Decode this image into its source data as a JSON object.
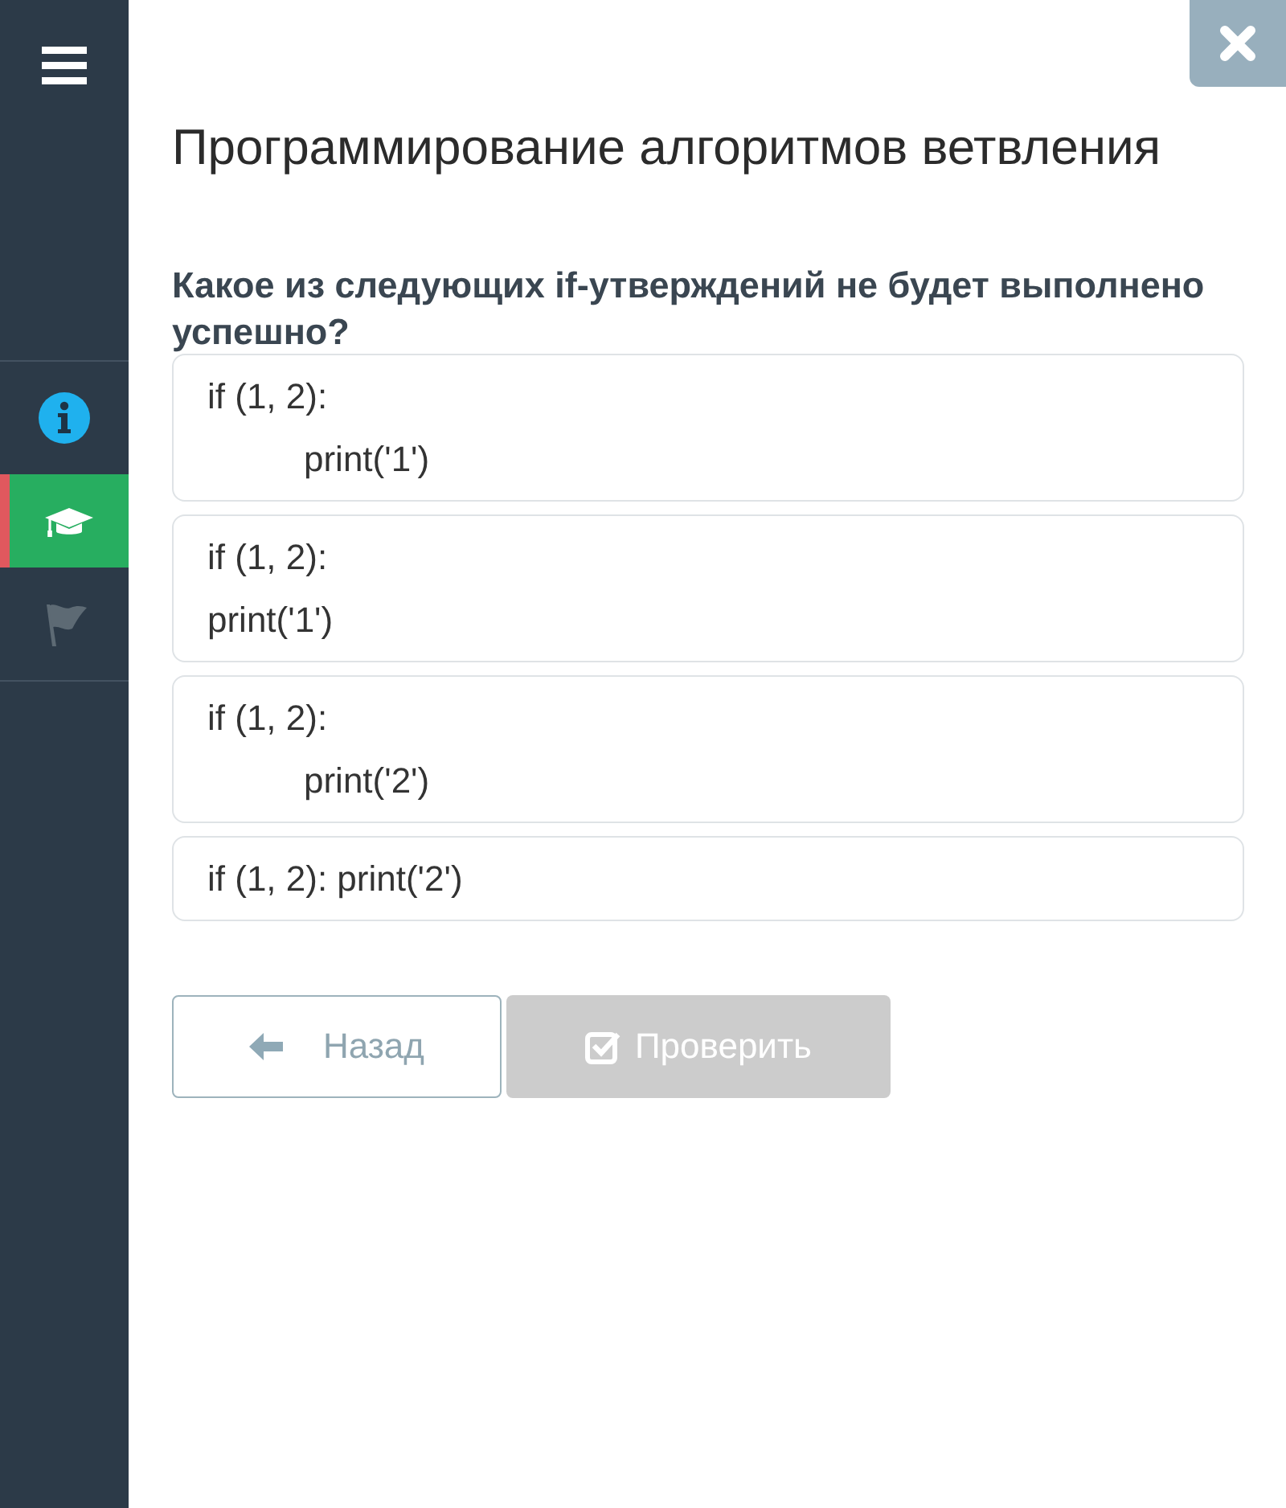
{
  "sidebar": {
    "items": [
      {
        "selected": false,
        "disabled": false
      },
      {
        "selected": true,
        "disabled": false
      },
      {
        "selected": false,
        "disabled": true
      }
    ]
  },
  "title": "Программирование алгоритмов ветвления",
  "question": "Какое из следующих if-утверждений не будет выполнено успешно?",
  "options": [
    {
      "selected": false,
      "lines": [
        {
          "text": "if (1, 2):",
          "children": [
            {
              "text": "print('1')"
            }
          ]
        }
      ]
    },
    {
      "selected": false,
      "lines": [
        {
          "text": "if (1, 2):"
        },
        {
          "text": "print('1')"
        }
      ]
    },
    {
      "selected": false,
      "lines": [
        {
          "text": "if (1, 2):",
          "children": [
            {
              "text": "print('2')"
            }
          ]
        }
      ]
    },
    {
      "selected": false,
      "lines": [
        {
          "text": "if (1, 2): print('2')"
        }
      ]
    }
  ],
  "buttons": [
    {
      "kind": "secondary",
      "label": "Назад",
      "disabled": false
    },
    {
      "kind": "primary",
      "label": "Проверить",
      "disabled": true
    }
  ]
}
